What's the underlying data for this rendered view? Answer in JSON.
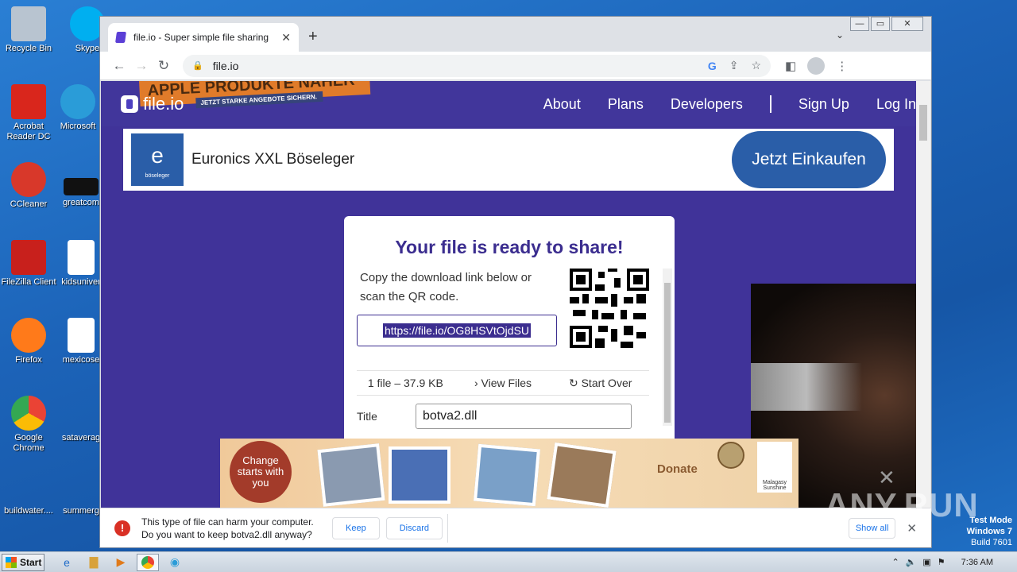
{
  "desktop_icons": [
    {
      "label": "Recycle Bin",
      "icon": "recycle-bin-icon",
      "color": "#b8c4d0"
    },
    {
      "label": "Skype",
      "icon": "skype-icon",
      "color": "#00aff0"
    },
    {
      "label": "Acrobat Reader DC",
      "icon": "acrobat-icon",
      "color": "#d9261c"
    },
    {
      "label": "Microsoft",
      "icon": "edge-icon",
      "color": "#2a9cd8"
    },
    {
      "label": "CCleaner",
      "icon": "ccleaner-icon",
      "color": "#d8382a"
    },
    {
      "label": "greatcom",
      "icon": "file-icon",
      "color": "#111111"
    },
    {
      "label": "FileZilla Client",
      "icon": "filezilla-icon",
      "color": "#c8201c"
    },
    {
      "label": "kidsuniver",
      "icon": "word-doc-icon",
      "color": "#ffffff"
    },
    {
      "label": "Firefox",
      "icon": "firefox-icon",
      "color": "#ff7a1a"
    },
    {
      "label": "mexicose",
      "icon": "word-doc-icon",
      "color": "#ffffff"
    },
    {
      "label": "Google Chrome",
      "icon": "chrome-icon",
      "color": "#34a853"
    },
    {
      "label": "sataverag",
      "icon": "file-icon",
      "color": "#1f6fc4"
    },
    {
      "label": "buildwater....",
      "icon": "file-icon",
      "color": "#1f6fc4"
    },
    {
      "label": "summerg",
      "icon": "file-icon",
      "color": "#1f6fc4"
    }
  ],
  "browser": {
    "tab_title": "file.io - Super simple file sharing",
    "url": "file.io",
    "new_tab": "+",
    "close": "✕"
  },
  "site": {
    "logo": "file.io",
    "ad_overlay_top": "APPLE PRODUKTE NÄHER",
    "ad_overlay_sub": "JETZT STARKE ANGEBOTE SICHERN.",
    "nav": {
      "about": "About",
      "plans": "Plans",
      "developers": "Developers",
      "signup": "Sign Up",
      "login": "Log In"
    }
  },
  "ad_banner": {
    "logo_text": "e",
    "logo_sub": "böseleger",
    "name": "Euronics XXL Böseleger",
    "cta": "Jetzt Einkaufen"
  },
  "share_card": {
    "heading": "Your file is ready to share!",
    "instructions": "Copy the download link below or scan the QR code.",
    "link": "https://file.io/OG8HSVtOjdSU",
    "file_count": "1 file – 37.9 KB",
    "view_files": "View Files",
    "start_over": "Start Over",
    "title_label": "Title",
    "title_value": "botva2.dll"
  },
  "bottom_ad": {
    "badge": "Change starts with you",
    "donate": "Donate",
    "seal": "Malagasy Sunshine"
  },
  "download_bar": {
    "message_line1": "This type of file can harm your computer.",
    "message_line2": "Do you want to keep botva2.dll anyway?",
    "keep": "Keep",
    "discard": "Discard",
    "show_all": "Show all"
  },
  "watermark": "ANY.RUN",
  "test_mode": {
    "line1": "Test Mode",
    "line2": "Windows 7",
    "line3": "Build 7601"
  },
  "taskbar": {
    "start": "Start",
    "clock": "7:36 AM"
  }
}
